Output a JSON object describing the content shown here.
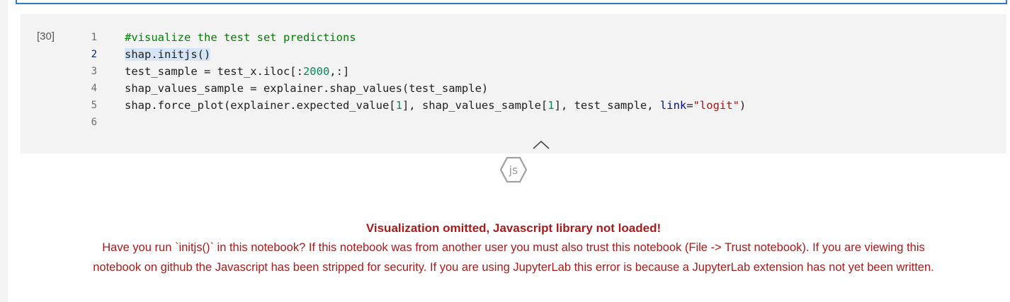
{
  "cell": {
    "execution_count": "[30]",
    "lines": [
      {
        "num": "1",
        "parts": [
          {
            "t": "#visualize the test set predictions",
            "c": "cm"
          }
        ]
      },
      {
        "num": "2",
        "active": true,
        "parts": [
          {
            "t": "shap.initjs()",
            "c": "sel"
          }
        ]
      },
      {
        "num": "3",
        "parts": [
          {
            "t": "test_sample = test_x.iloc[:"
          },
          {
            "t": "2000",
            "c": "num"
          },
          {
            "t": ",:]"
          }
        ]
      },
      {
        "num": "4",
        "parts": [
          {
            "t": "shap_values_sample = explainer.shap_values(test_sample)"
          }
        ]
      },
      {
        "num": "5",
        "parts": [
          {
            "t": "shap.force_plot(explainer.expected_value["
          },
          {
            "t": "1",
            "c": "num"
          },
          {
            "t": "], shap_values_sample["
          },
          {
            "t": "1",
            "c": "num"
          },
          {
            "t": "], test_sample, "
          },
          {
            "t": "link",
            "c": "kw"
          },
          {
            "t": "="
          },
          {
            "t": "\"logit\"",
            "c": "str"
          },
          {
            "t": ")"
          }
        ]
      },
      {
        "num": "6",
        "parts": []
      }
    ]
  },
  "icons": {
    "collapse": "chevron-up-icon",
    "js": "js-icon"
  },
  "js_badge_label": "js",
  "output": {
    "title": "Visualization omitted, Javascript library not loaded!",
    "message_line1": "Have you run `initjs()` in this notebook? If this notebook was from another user you must also trust this notebook (File -> Trust notebook). If you are viewing this",
    "message_line2": "notebook on github the Javascript has been stripped for security. If you are using JupyterLab this error is because a JupyterLab extension has not yet been written.",
    "color": "#a51c1c"
  },
  "colors": {
    "cell_background": "#f3f3f3",
    "focus_border": "#2f7bc7",
    "comment": "#008000",
    "number": "#098658",
    "string": "#a31515"
  }
}
